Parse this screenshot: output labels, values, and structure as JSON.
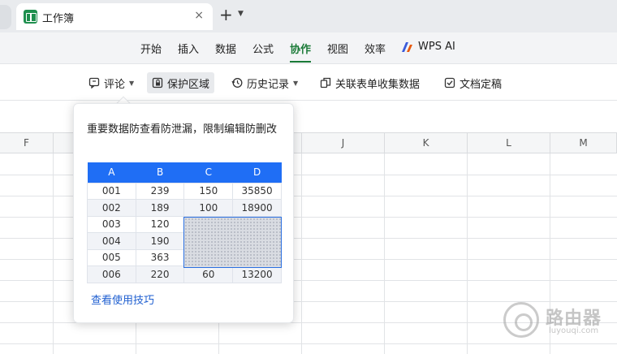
{
  "tab": {
    "title": "工作簿",
    "close": "×",
    "new": "+",
    "more": "⌄"
  },
  "menu": {
    "items": [
      "开始",
      "插入",
      "数据",
      "公式",
      "协作",
      "视图",
      "效率",
      "WPS AI"
    ],
    "active": "协作"
  },
  "toolbar": {
    "comment": "评论",
    "protect": "保护区域",
    "history": "历史记录",
    "related": "关联表单收集数据",
    "finalize": "文档定稿"
  },
  "sheet": {
    "columns": [
      "F",
      "J",
      "K",
      "L",
      "M"
    ]
  },
  "popup": {
    "description": "重要数据防查看防泄漏，限制编辑防删改",
    "link": "查看使用技巧",
    "table": {
      "headers": [
        "A",
        "B",
        "C",
        "D"
      ],
      "rows": [
        [
          "001",
          "239",
          "150",
          "35850"
        ],
        [
          "002",
          "189",
          "100",
          "18900"
        ],
        [
          "003",
          "120",
          "",
          ""
        ],
        [
          "004",
          "190",
          "",
          ""
        ],
        [
          "005",
          "363",
          "",
          ""
        ],
        [
          "006",
          "220",
          "60",
          "13200"
        ]
      ]
    }
  },
  "watermark": {
    "text": "路由器",
    "sub": "luyouqi.com"
  },
  "colors": {
    "accent": "#1a7a37",
    "header_blue": "#1f6ef5",
    "link": "#1f5fd0"
  }
}
